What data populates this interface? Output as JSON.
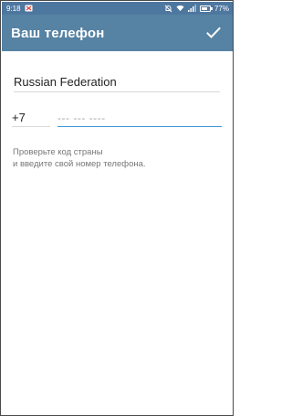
{
  "status_bar": {
    "time": "9:18",
    "battery_text": "77%",
    "battery_level": 0.77,
    "icons": [
      "mail-notification-icon",
      "alarm-off-icon",
      "wifi-icon",
      "signal-icon",
      "battery-icon"
    ]
  },
  "app_bar": {
    "title": "Ваш телефон",
    "done_icon": "check-icon"
  },
  "form": {
    "country": "Russian Federation",
    "country_code": "+7",
    "phone_value": "",
    "phone_placeholder": "--- --- ----"
  },
  "hint": {
    "line1": "Проверьте код страны",
    "line2": "и введите свой номер телефона."
  },
  "colors": {
    "status_bar": "#4e77a0",
    "app_bar": "#5682a3",
    "accent": "#3a95d5"
  }
}
